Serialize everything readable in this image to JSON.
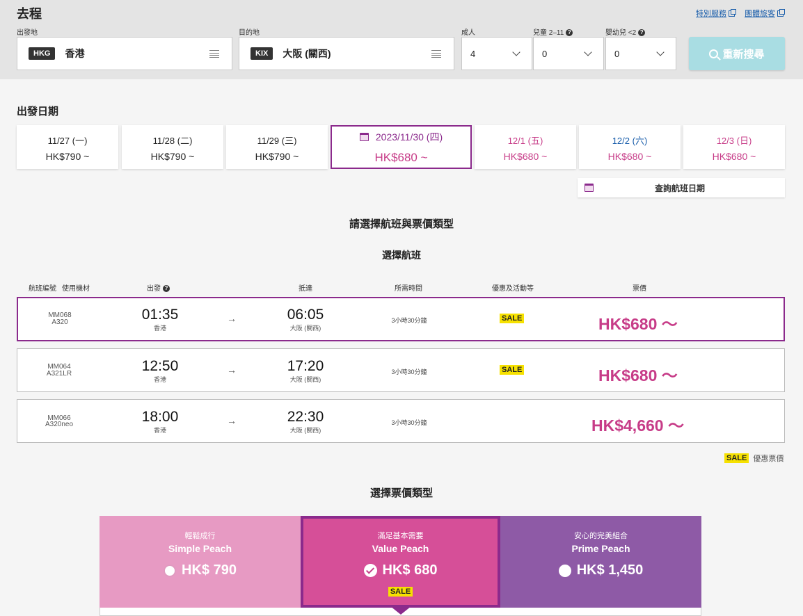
{
  "header": {
    "title": "去程",
    "links": [
      {
        "label": "特別服務"
      },
      {
        "label": "團體旅客"
      }
    ]
  },
  "search": {
    "origin_label": "出發地",
    "origin_code": "HKG",
    "origin_name": "香港",
    "destination_label": "目的地",
    "destination_code": "KIX",
    "destination_name": "大阪 (關西)",
    "adults_label": "成人",
    "adults_value": "4",
    "children_label": "兒童 2–11",
    "children_value": "0",
    "infants_label": "嬰幼兒 <2",
    "infants_value": "0",
    "search_button": "重新搜尋"
  },
  "dates": {
    "title": "出發日期",
    "tabs": [
      {
        "date": "11/27 (一)",
        "price": "HK$790 ~"
      },
      {
        "date": "11/28 (二)",
        "price": "HK$790 ~"
      },
      {
        "date": "11/29 (三)",
        "price": "HK$790 ~"
      },
      {
        "date": "2023/11/30 (四)",
        "price": "HK$680 ~"
      },
      {
        "date": "12/1 (五)",
        "price": "HK$680 ~"
      },
      {
        "date": "12/2 (六)",
        "price": "HK$680 ~"
      },
      {
        "date": "12/3 (日)",
        "price": "HK$680 ~"
      }
    ],
    "schedule_button": "查詢航班日期"
  },
  "flights": {
    "heading": "請選擇航班與票價類型",
    "subheading": "選擇航班",
    "columns": {
      "flight_no": "航班編號",
      "aircraft": "使用機材",
      "depart": "出發",
      "arrive": "抵達",
      "duration": "所需時間",
      "promo": "優惠及活動等",
      "fare": "票價"
    },
    "rows": [
      {
        "flight": "MM068",
        "aircraft": "A320",
        "dep_time": "01:35",
        "dep_city": "香港",
        "arrow": "→",
        "arr_time": "06:05",
        "arr_city": "大阪 (關西)",
        "duration": "3小時30分鐘",
        "sale": "SALE",
        "price": "HK$680 ～"
      },
      {
        "flight": "MM064",
        "aircraft": "A321LR",
        "dep_time": "12:50",
        "dep_city": "香港",
        "arrow": "→",
        "arr_time": "17:20",
        "arr_city": "大阪 (關西)",
        "duration": "3小時30分鐘",
        "sale": "SALE",
        "price": "HK$680 ～"
      },
      {
        "flight": "MM066",
        "aircraft": "A320neo",
        "dep_time": "18:00",
        "dep_city": "香港",
        "arrow": "→",
        "arr_time": "22:30",
        "arr_city": "大阪 (關西)",
        "duration": "3小時30分鐘",
        "sale": "",
        "price": "HK$4,660 ～"
      }
    ],
    "legend_badge": "SALE",
    "legend_text": "優惠票價"
  },
  "fares": {
    "heading": "選擇票價類型",
    "types": [
      {
        "sub": "輕鬆成行",
        "name": "Simple Peach",
        "price": "HK$ 790",
        "color": "#e79ac3"
      },
      {
        "sub": "滿足基本需要",
        "name": "Value Peach",
        "price": "HK$ 680",
        "badge": "SALE",
        "color": "#d64f98"
      },
      {
        "sub": "安心的完美組合",
        "name": "Prime Peach",
        "price": "HK$ 1,450",
        "color": "#8e5aa6"
      }
    ]
  },
  "colors": {
    "brand_purple": "#8b2a8c",
    "price_pink": "#c73c88",
    "sale_yellow": "#f6e100",
    "search_button": "#a9dde3"
  }
}
